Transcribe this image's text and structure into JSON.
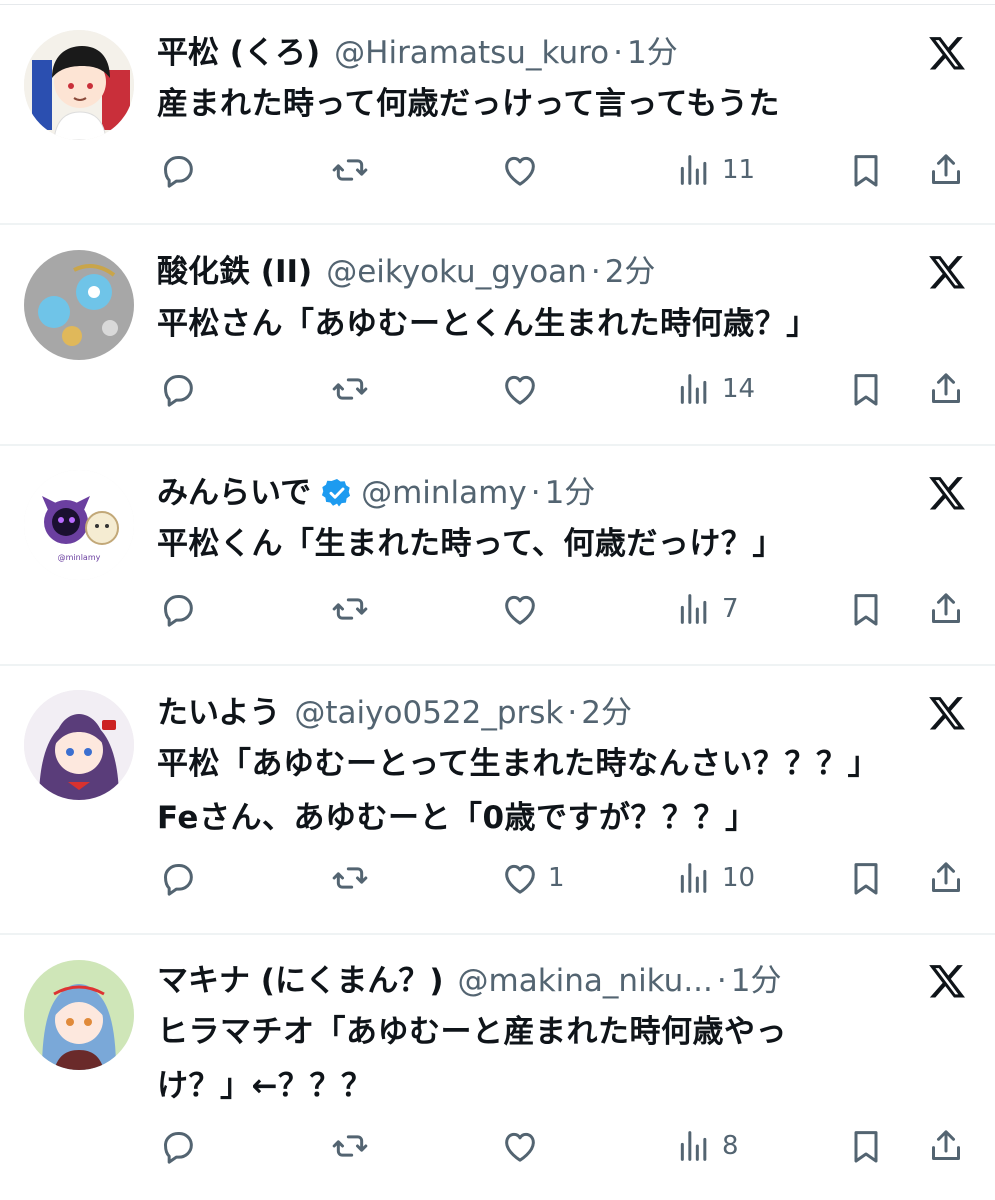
{
  "tweets": [
    {
      "display_name": "平松 (くろ)",
      "handle": "@Hiramatsu_kuro",
      "separator": "·",
      "time": "1分",
      "verified": false,
      "lines": [
        "産まれた時って何歳だっけって言ってもうた"
      ],
      "likes": "",
      "views": "11",
      "avatar_color": "#c92f3a"
    },
    {
      "display_name": "酸化鉄 (II)",
      "handle": "@eikyoku_gyoan",
      "separator": "·",
      "time": "2分",
      "verified": false,
      "lines": [
        "平松さん「あゆむーとくん生まれた時何歳？」"
      ],
      "likes": "",
      "views": "14",
      "avatar_color": "#9a9a9a"
    },
    {
      "display_name": "みんらいで",
      "handle": "@minlamy",
      "separator": "·",
      "time": "1分",
      "verified": true,
      "lines": [
        "平松くん「生まれた時って、何歳だっけ？」"
      ],
      "likes": "",
      "views": "7",
      "avatar_color": "#6b3fa0",
      "avatar_text": "@minlamy"
    },
    {
      "display_name": "たいよう",
      "handle": "@taiyo0522_prsk",
      "separator": "·",
      "time": "2分",
      "verified": false,
      "lines": [
        "平松「あゆむーとって生まれた時なんさい？？？」",
        "Feさん、あゆむーと「0歳ですが？？？」"
      ],
      "likes": "1",
      "views": "10",
      "avatar_color": "#5a3d7a"
    },
    {
      "display_name": "マキナ (にくまん？)",
      "handle": "@makina_niku...",
      "separator": "·",
      "time": "1分",
      "verified": false,
      "lines": [
        "ヒラマチオ「あゆむーと産まれた時何歳やっ",
        "け？」←？？？"
      ],
      "likes": "",
      "views": "8",
      "avatar_color": "#7aa8d8"
    }
  ],
  "icons": {
    "reply": "reply-icon",
    "retweet": "retweet-icon",
    "like": "like-icon",
    "views": "views-icon",
    "bookmark": "bookmark-icon",
    "share": "share-icon",
    "logo": "x-logo-icon",
    "verified": "verified-badge-icon"
  },
  "colors": {
    "text": "#0f1419",
    "secondary": "#536471",
    "verified": "#1d9bf0",
    "divider": "#eff3f4"
  }
}
